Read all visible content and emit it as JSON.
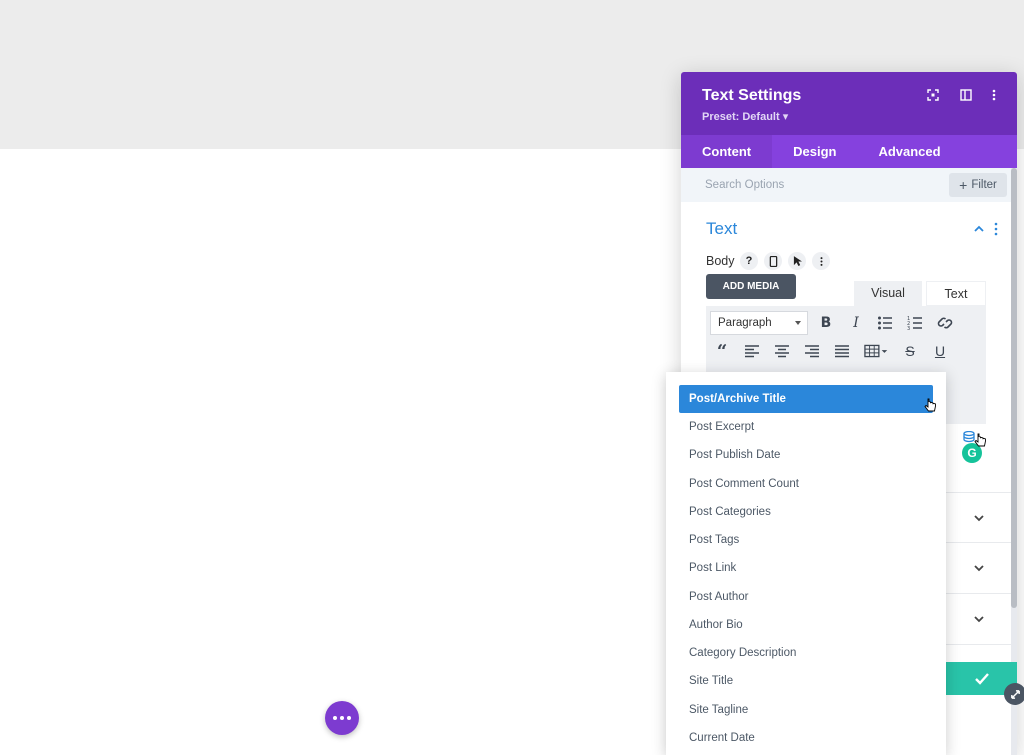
{
  "panel": {
    "title": "Text Settings",
    "preset": "Preset: Default ▾",
    "tabs": [
      "Content",
      "Design",
      "Advanced"
    ],
    "active_tab": "Content"
  },
  "search": {
    "placeholder": "Search Options",
    "filter_label": "Filter"
  },
  "section": {
    "title": "Text",
    "body_label": "Body"
  },
  "editor": {
    "add_media": "ADD MEDIA",
    "tab_visual": "Visual",
    "tab_text": "Text",
    "format_select": "Paragraph"
  },
  "dropdown": {
    "items": [
      "Post/Archive Title",
      "Post Excerpt",
      "Post Publish Date",
      "Post Comment Count",
      "Post Categories",
      "Post Tags",
      "Post Link",
      "Post Author",
      "Author Bio",
      "Category Description",
      "Site Title",
      "Site Tagline",
      "Current Date"
    ],
    "highlighted": "Post/Archive Title"
  },
  "colors": {
    "header_purple": "#6c2eb9",
    "tabs_purple": "#8541de",
    "accent_blue": "#2b87da",
    "save_green": "#29c4a9",
    "fab_purple": "#7d3bd0"
  },
  "icons": {
    "header": [
      "focus-icon",
      "split-view-icon",
      "more-vertical-icon"
    ],
    "grammarly": "G"
  }
}
